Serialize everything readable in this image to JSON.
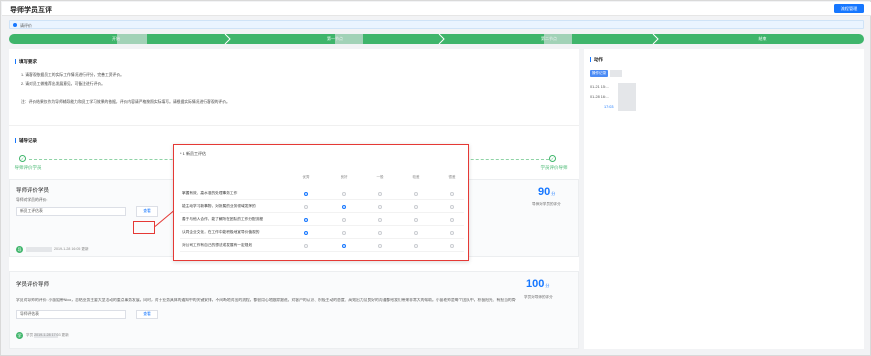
{
  "header": {
    "title": "导师学员互评",
    "flow_button": "流程管理"
  },
  "notice": {
    "text": "请评价"
  },
  "steps": [
    "开始",
    "第一节点",
    "第二节点",
    "结束"
  ],
  "requirements": {
    "title": "填写要求",
    "lines": [
      "1. 请客观依据员工的实际工作情况进行评分，完善工资评价。",
      "2. 请对员工做推荐出发展意见，可备注进行评价。",
      "注：评价结果仅作为导师辅导能力和员工学习效果的依据，评价内容请严格按照实际填写。请根据实际情况进行客观的评价。"
    ]
  },
  "records": {
    "title": "辅导记录",
    "stage_left": "导师评价学员",
    "stage_right": "学员评价导师"
  },
  "card1": {
    "title": "导师评价学员",
    "sub": "导师对学员的评价:",
    "input_value": "新员工评估表",
    "view_button": "查看",
    "score": "90",
    "score_unit": "分",
    "score_label": "导师对学员的评分",
    "avatar": "导",
    "meta": "2019-1-28 16:05 更新"
  },
  "card2": {
    "title": "学员评价导师",
    "sub": "学员对导师的评价: 小苗姐带Nico，总结业务主要大型活动的重点事务发展，同时，对于业务具体的通知中的关键安排，不间断地对出的流程，都很用心地跟踪跟进。对客户的认识、积极主动的态度、高效出力及良好的沟通都给我们带来非常大的帮助。小苗老师是每个团队中，积极阳光、有担当的骨干，保持激情这一点值得学习，总体考评给予很好的评价。",
    "input_value": "导师评估表",
    "view_button": "查看",
    "score": "100",
    "score_unit": "分",
    "score_label": "学员对导师的评分",
    "avatar": "学",
    "meta": "学员 2019-1-28 17:03 更新"
  },
  "popup": {
    "title": "* 1 新员工评估",
    "columns": [
      "优秀",
      "良好",
      "一般",
      "较差",
      "很差"
    ],
    "rows": [
      {
        "label": "掌握有效、高水准的处理事务工作",
        "selected": 0
      },
      {
        "label": "能主动学习新事物，对所属的业务领域发挥的",
        "selected": 1
      },
      {
        "label": "善于与他人合作，能了解所在团队的工作分配流程",
        "selected": 0
      },
      {
        "label": "认同企业文化，在工作中能积极地宣导价值观的",
        "selected": 0
      },
      {
        "label": "对公司工作有自己的想法或发展有一定规划",
        "selected": 1
      }
    ]
  },
  "side": {
    "title": "动作",
    "tab": "操作记录",
    "lines": [
      "01-21 15:...",
      "01-28 16:...",
      "17:03"
    ]
  },
  "colors": {
    "accent": "#1677ff",
    "success": "#3fb56b",
    "highlight": "#e53935"
  }
}
